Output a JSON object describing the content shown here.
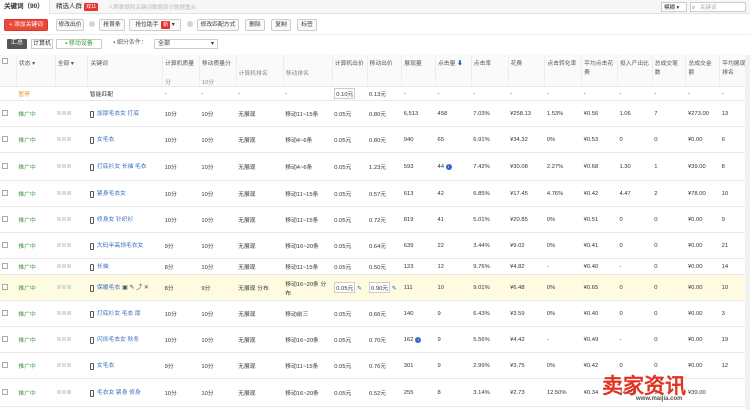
{
  "tabs": [
    {
      "label": "关键词（90）"
    },
    {
      "label": "精选人群",
      "badge": "双11"
    }
  ],
  "tip": "人群数据和关键词数据部分数据重合",
  "mode_select": "模糊",
  "search_placeholder": "关键词",
  "toolbar": {
    "add": "+ 添加关键词",
    "edit_bid": "修改出价",
    "rob_rank": "抢首条",
    "rank_helper": "抢位助手",
    "rank_new": "新",
    "edit_match": "修改匹配方式",
    "delete": "删除",
    "copy": "复制",
    "tag": "标签"
  },
  "filters": {
    "summary": "汇总",
    "pc": "计算机",
    "mobile": "移动设备",
    "segment_label": "细分条件：",
    "segment_value": "全部"
  },
  "columns": {
    "status": "状态",
    "all": "全部",
    "keyword": "关键词",
    "pc_quality": "计算机质量",
    "pc_quality_sub": "分",
    "mobile_quality": "移动质量分",
    "mobile_quality_sub": "10分",
    "pc_rank": "计算机排名",
    "mobile_rank": "移动排名",
    "pc_bid": "计算机出价",
    "mobile_bid": "移动出价",
    "impressions": "展现量",
    "clicks": "点击量",
    "ctr": "点击率",
    "cost": "花费",
    "conv": "点击转化率",
    "avg_cpc": "平均点击花费",
    "roi": "投入产出比",
    "total_fav": "总成交笔数",
    "total_amt": "总成交金额",
    "avg_rank": "平均展现排名"
  },
  "smart_row": {
    "status": "暂停",
    "keyword": "智能匹配",
    "pc_bid": "0.10元",
    "mobile_bid": "0.13元"
  },
  "rows": [
    {
      "status": "推广中",
      "kw": "加厚毛衣女 打底",
      "pq": "10分",
      "mq": "10分",
      "pr": "无展现",
      "mr": "移动11~15条",
      "pb": "0.05元",
      "mb": "0.80元",
      "imp": "6,513",
      "clk": "458",
      "ctr": "7.03%",
      "cost": "¥258.13",
      "conv": "1.53%",
      "cpc": "¥0.56",
      "roi": "1.06",
      "fav": "7",
      "amt": "¥273.00",
      "avg": "13"
    },
    {
      "status": "推广中",
      "kw": "女毛衣",
      "pq": "10分",
      "mq": "10分",
      "pr": "无展现",
      "mr": "移动4~6条",
      "pb": "0.05元",
      "mb": "0.80元",
      "imp": "940",
      "clk": "65",
      "ctr": "6.91%",
      "cost": "¥34.32",
      "conv": "0%",
      "cpc": "¥0.53",
      "roi": "0",
      "fav": "0",
      "amt": "¥0.00",
      "avg": "6"
    },
    {
      "status": "推广中",
      "kw": "打底衫女 长袖 毛衣",
      "pq": "10分",
      "mq": "10分",
      "pr": "无展现",
      "mr": "移动4~6条",
      "pb": "0.05元",
      "mb": "1.23元",
      "imp": "593",
      "clk": "44",
      "ctr": "7.42%",
      "cost": "¥30.08",
      "conv": "2.27%",
      "cpc": "¥0.68",
      "roi": "1.30",
      "fav": "1",
      "amt": "¥39.00",
      "avg": "8"
    },
    {
      "status": "推广中",
      "kw": "紧身毛衣女",
      "pq": "10分",
      "mq": "10分",
      "pr": "无展现",
      "mr": "移动11~15条",
      "pb": "0.05元",
      "mb": "0.57元",
      "imp": "613",
      "clk": "42",
      "ctr": "6.85%",
      "cost": "¥17.45",
      "conv": "4.76%",
      "cpc": "¥0.42",
      "roi": "4.47",
      "fav": "2",
      "amt": "¥78.00",
      "avg": "10"
    },
    {
      "status": "推广中",
      "kw": "修身女 针织衫",
      "pq": "10分",
      "mq": "10分",
      "pr": "无展现",
      "mr": "移动11~15条",
      "pb": "0.05元",
      "mb": "0.72元",
      "imp": "819",
      "clk": "41",
      "ctr": "5.01%",
      "cost": "¥20.85",
      "conv": "0%",
      "cpc": "¥0.51",
      "roi": "0",
      "fav": "0",
      "amt": "¥0.00",
      "avg": "9"
    },
    {
      "status": "推广中",
      "kw": "大码半高领毛衣女",
      "pq": "9分",
      "mq": "10分",
      "pr": "无展现",
      "mr": "移动16~20条",
      "pb": "0.05元",
      "mb": "0.64元",
      "imp": "639",
      "clk": "22",
      "ctr": "3.44%",
      "cost": "¥9.02",
      "conv": "0%",
      "cpc": "¥0.41",
      "roi": "0",
      "fav": "0",
      "amt": "¥0.00",
      "avg": "21"
    },
    {
      "status": "推广中",
      "kw": "长袖",
      "pq": "8分",
      "mq": "10分",
      "pr": "无展现",
      "mr": "移动11~15条",
      "pb": "0.05元",
      "mb": "0.50元",
      "imp": "123",
      "clk": "12",
      "ctr": "9.76%",
      "cost": "¥4.82",
      "conv": "-",
      "cpc": "¥0.40",
      "roi": "-",
      "fav": "0",
      "amt": "¥0.00",
      "avg": "14"
    },
    {
      "status": "推广中",
      "kw": "保暖毛衣",
      "pq": "8分",
      "mq": "9分",
      "pr": "无展现 分布",
      "mr": "移动16~20条 分布",
      "pb": "0.05元",
      "mb": "0.90元",
      "imp": "111",
      "clk": "10",
      "ctr": "9.01%",
      "cost": "¥6.48",
      "conv": "0%",
      "cpc": "¥0.65",
      "roi": "0",
      "fav": "0",
      "amt": "¥0.00",
      "avg": "10",
      "hl": true
    },
    {
      "status": "推广中",
      "kw": "打底衫女 毛衣 厚",
      "pq": "10分",
      "mq": "10分",
      "pr": "无展现",
      "mr": "移动前三",
      "pb": "0.05元",
      "mb": "0.66元",
      "imp": "140",
      "clk": "9",
      "ctr": "6.43%",
      "cost": "¥3.59",
      "conv": "0%",
      "cpc": "¥0.40",
      "roi": "0",
      "fav": "0",
      "amt": "¥0.00",
      "avg": "3"
    },
    {
      "status": "推广中",
      "kw": "闪烁毛衣女 秋冬",
      "pq": "10分",
      "mq": "10分",
      "pr": "无展现",
      "mr": "移动16~20条",
      "pb": "0.05元",
      "mb": "0.70元",
      "imp": "162",
      "clk": "9",
      "ctr": "5.56%",
      "cost": "¥4.42",
      "conv": "-",
      "cpc": "¥0.49",
      "roi": "-",
      "fav": "0",
      "amt": "¥0.00",
      "avg": "19"
    },
    {
      "status": "推广中",
      "kw": "女毛衣",
      "pq": "9分",
      "mq": "10分",
      "pr": "无展现",
      "mr": "移动11~15条",
      "pb": "0.05元",
      "mb": "0.76元",
      "imp": "301",
      "clk": "9",
      "ctr": "2.99%",
      "cost": "¥3.75",
      "conv": "0%",
      "cpc": "¥0.42",
      "roi": "0",
      "fav": "0",
      "amt": "¥0.00",
      "avg": "12"
    },
    {
      "status": "推广中",
      "kw": "毛衣女 紧身 修身",
      "pq": "10分",
      "mq": "10分",
      "pr": "无展现",
      "mr": "移动16~20条",
      "pb": "0.05元",
      "mb": "0.52元",
      "imp": "255",
      "clk": "8",
      "ctr": "3.14%",
      "cost": "¥2.73",
      "conv": "12.50%",
      "cpc": "¥0.34",
      "roi": "14.29",
      "fav": "1",
      "amt": "¥39.00",
      "avg": ""
    }
  ],
  "watermark": {
    "text": "卖家资讯",
    "url": "www.maijia.com"
  },
  "colors": {
    "accent": "#ea4a3b",
    "status_green": "#3a9b35",
    "status_orange": "#e69a1c",
    "link": "#3a6fbf"
  }
}
